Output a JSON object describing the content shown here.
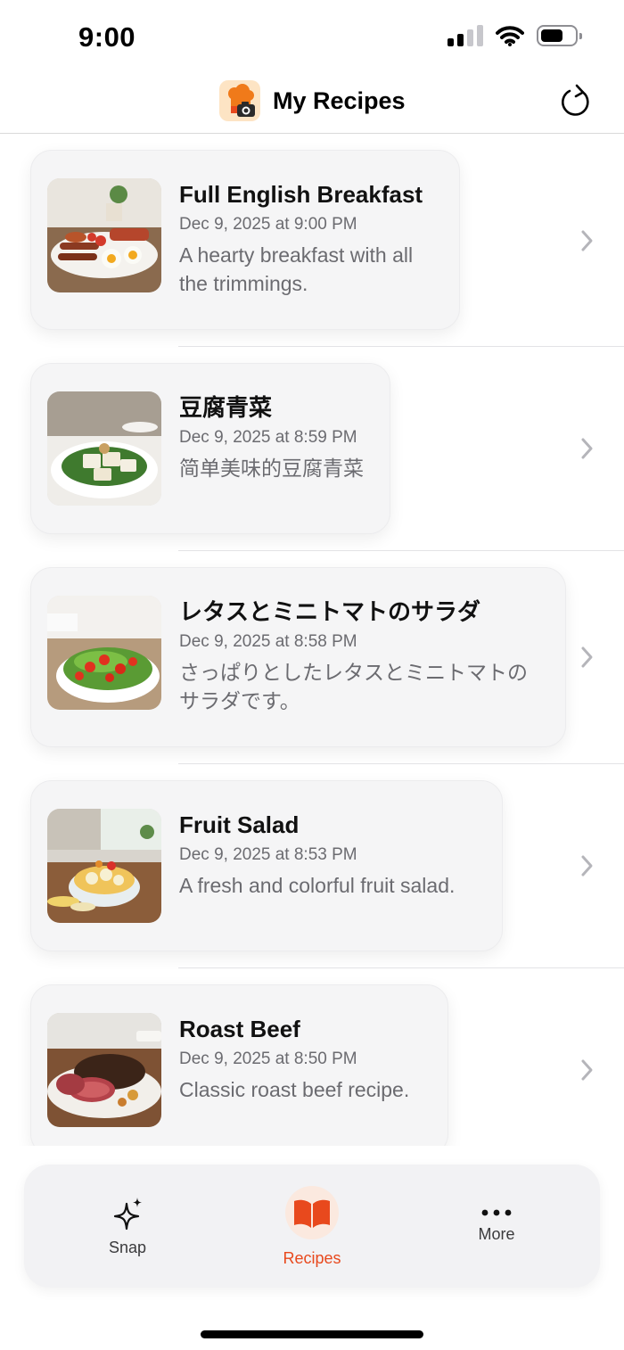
{
  "status_bar": {
    "time": "9:00",
    "icons": [
      "cellular-signal-icon",
      "wifi-icon",
      "battery-icon"
    ]
  },
  "header": {
    "title": "My Recipes",
    "app_icon": "chef-hat-camera-icon",
    "refresh_icon": "refresh-icon"
  },
  "recipes": [
    {
      "title": "Full English Breakfast",
      "date": "Dec 9, 2025 at 9:00 PM",
      "description": "A hearty breakfast with all the trimmings."
    },
    {
      "title": "豆腐青菜",
      "date": "Dec 9, 2025 at 8:59 PM",
      "description": "简单美味的豆腐青菜"
    },
    {
      "title": "レタスとミニトマトのサラダ",
      "date": "Dec 9, 2025 at 8:58 PM",
      "description": "さっぱりとしたレタスとミニトマトのサラダです。"
    },
    {
      "title": "Fruit Salad",
      "date": "Dec 9, 2025 at 8:53 PM",
      "description": "A fresh and colorful fruit salad."
    },
    {
      "title": "Roast Beef",
      "date": "Dec 9, 2025 at 8:50 PM",
      "description": "Classic roast beef recipe."
    }
  ],
  "tab_bar": {
    "tabs": [
      {
        "label": "Snap",
        "icon": "sparkles-icon",
        "active": false
      },
      {
        "label": "Recipes",
        "icon": "open-book-icon",
        "active": true
      },
      {
        "label": "More",
        "icon": "ellipsis-icon",
        "active": false
      }
    ]
  },
  "colors": {
    "accent": "#e8491d",
    "app_icon_bg": "#fde4c4",
    "card_bg": "#f5f5f6",
    "secondary_text": "#6b6b70"
  }
}
